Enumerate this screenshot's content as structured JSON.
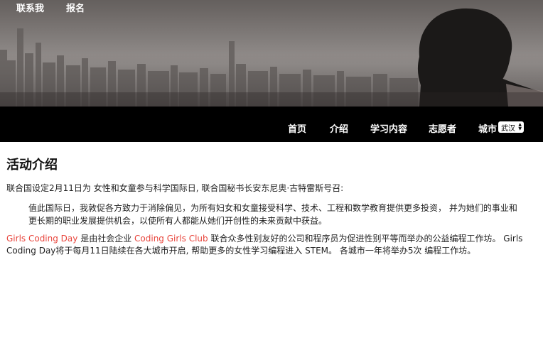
{
  "header": {
    "contact_label": "联系我",
    "signup_label": "报名"
  },
  "nav": {
    "home": "首页",
    "intro": "介绍",
    "learning": "学习内容",
    "volunteers": "志愿者",
    "city_label": "城市",
    "city_selected": "武汉"
  },
  "content": {
    "title": "活动介绍",
    "intro_line": "联合国设定2月11日为 女性和女童参与科学国际日, 联合国秘书长安东尼奥·古特雷斯号召:",
    "quote": "值此国际日，我敦促各方致力于消除偏见，为所有妇女和女童接受科学、技术、工程和数学教育提供更多投资， 并为她们的事业和更长期的职业发展提供机会，以使所有人都能从她们开创性的未来贡献中获益。",
    "para_link1": "Girls Coding Day",
    "para_text1": " 是由社会企业 ",
    "para_link2": "Coding Girls Club",
    "para_text2": " 联合众多性别友好的公司和程序员为促进性别平等而举办的公益编程工作坊。 Girls Coding Day将于每月11日陆续在各大城市开启, 帮助更多的女性学习编程进入 STEM。 各城市一年将举办5次 编程工作坊。"
  },
  "colors": {
    "accent": "#e8453c",
    "navbar": "#000000"
  }
}
